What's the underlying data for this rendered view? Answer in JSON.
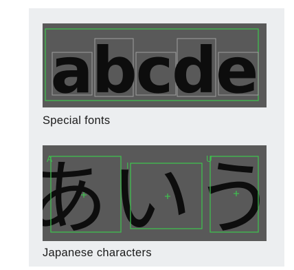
{
  "examples": [
    {
      "caption": "Special fonts",
      "sample_text": "abcde"
    },
    {
      "caption": "Japanese characters",
      "sample_text": "あいう",
      "box_labels": [
        "A",
        "I",
        "U"
      ]
    }
  ],
  "colors": {
    "panel_bg": "#eceef0",
    "image_bg": "#595959",
    "box_green": "#3fbf4f",
    "glyph": "#0d0d0d",
    "char_box_gray": "#a0a0a0"
  }
}
